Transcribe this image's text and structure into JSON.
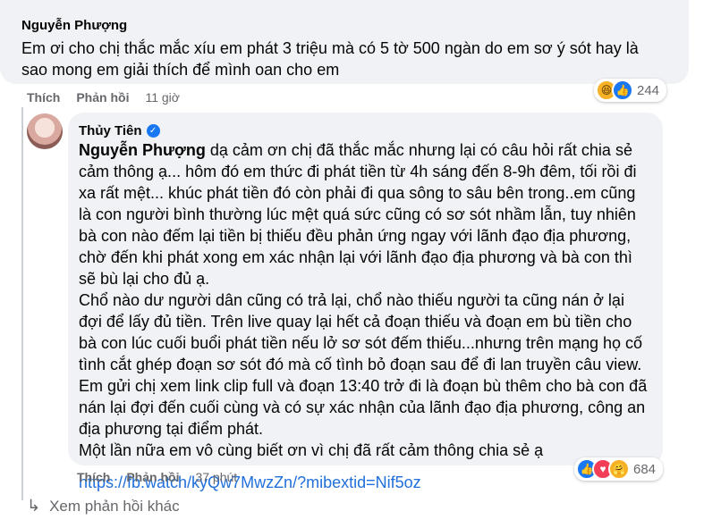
{
  "comment1": {
    "author": "Nguyễn Phượng",
    "text": "Em ơi cho chị thắc mắc xíu em phát 3 triệu mà có 5 tờ 500 ngàn do em sơ ý sót hay là sao mong em giải thích để mình oan cho em",
    "actions": {
      "like": "Thích",
      "reply": "Phản hồi",
      "time": "11 giờ"
    },
    "reactions": {
      "count": "244",
      "icons": [
        "haha-icon",
        "like-icon"
      ]
    }
  },
  "reply1": {
    "author": "Thủy Tiên",
    "mention": "Nguyễn Phượng",
    "paragraph1_rest": " dạ cảm ơn chị đã thắc mắc nhưng lại có câu hỏi rất chia sẻ cảm thông ạ... hôm đó em thức đi phát tiền từ 4h sáng đến 8-9h đêm, tối rồi đi xa rất mệt... khúc phát tiền đó còn phải đi qua sông to sâu bên trong..em cũng là con người bình thường lúc mệt quá sức cũng có sơ sót nhầm lẫn, tuy nhiên bà con nào đếm lại tiền bị thiếu đều phản ứng ngay với lãnh đạo địa phương, chờ đến khi phát xong em xác nhận lại với lãnh đạo địa phương và bà con thì sẽ bù lại cho đủ ạ.",
    "paragraph2": "Chổ nào dư người dân cũng có trả lại, chổ nào thiếu người ta cũng nán ở lại đợi để lấy đủ tiền. Trên live quay lại hết cả đoạn thiếu và đoạn em bù tiền cho bà con lúc cuối buổi phát tiền nếu lở sơ sót đếm thiếu...nhưng trên mạng họ cố tình cắt ghép đoạn sơ sót đó mà cố tình bỏ đoạn sau để đi lan truyền câu view.",
    "paragraph3": "Em gửi chị xem link clip full và đoạn 13:40 trở đi là đoạn bù thêm cho bà con đã nán lại đợi đến cuối cùng và có sự xác nhận của lãnh đạo địa phương, công an địa phương tại điểm phát.",
    "paragraph4": "Một lần nữa em vô cùng biết ơn vì chị đã rất cảm thông chia sẻ ạ",
    "link": "https://fb.watch/kyQw7MwzZn/?mibextid=Nif5oz",
    "actions": {
      "like": "Thích",
      "reply": "Phản hồi",
      "time": "37 phút"
    },
    "reactions": {
      "count": "684",
      "icons": [
        "like-icon",
        "love-icon",
        "care-icon"
      ]
    }
  },
  "more_replies": "Xem phản hồi khác",
  "colors": {
    "bubble": "#f0f2f5",
    "link": "#216fdb",
    "meta": "#65676b",
    "like_blue": "#1877f2"
  }
}
